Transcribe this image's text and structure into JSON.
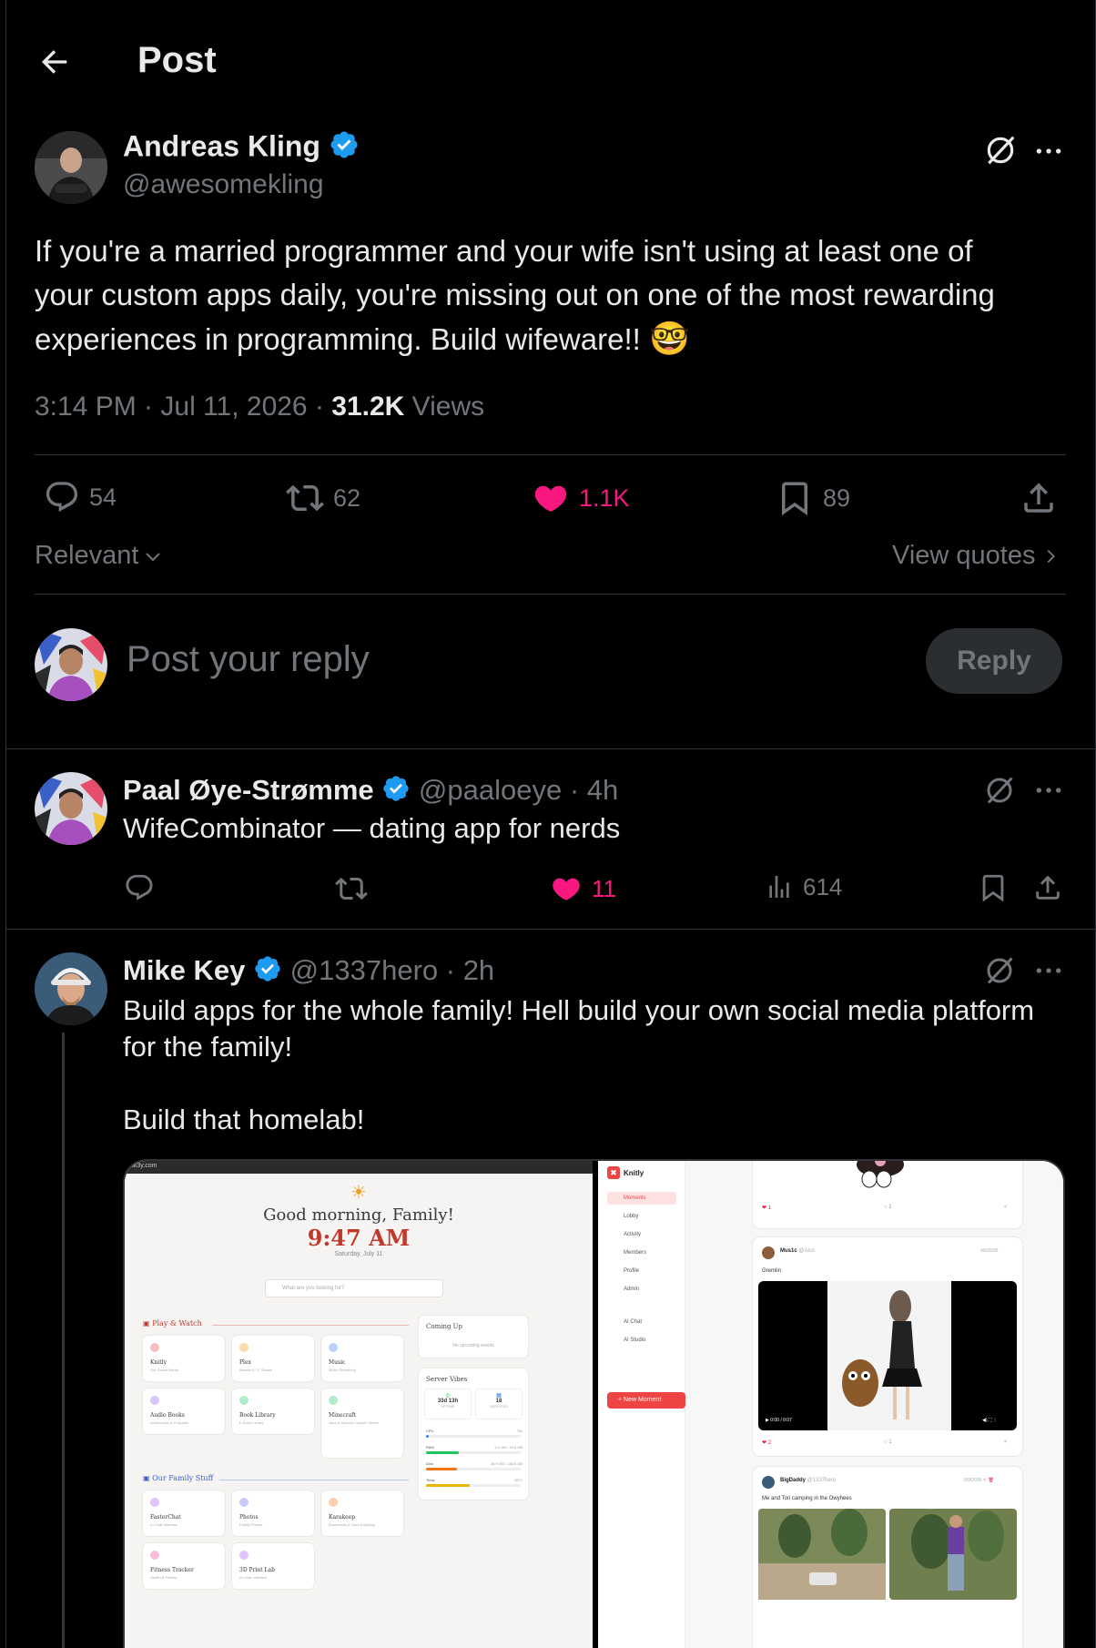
{
  "header": {
    "title": "Post"
  },
  "main_post": {
    "author_name": "Andreas Kling",
    "handle": "@awesomekling",
    "text_line1": "If you're a married programmer and your wife isn't using at least one of",
    "text_line2": "your custom apps daily, you're missing out on one of the most rewarding",
    "text_line3": "experiences in programming. Build wifeware!!",
    "emoji": "🤓",
    "time": "3:14 PM · Jul 11, 2026 · ",
    "views_count": "31.2K",
    "views_label": " Views",
    "replies": "54",
    "reposts": "62",
    "likes": "1.1K",
    "bookmarks": "89"
  },
  "sort": {
    "label": "Relevant",
    "view_quotes": "View quotes"
  },
  "composer": {
    "placeholder": "Post your reply",
    "button": "Reply"
  },
  "reply1": {
    "author_name": "Paal Øye-Strømme",
    "handle": "@paaloeye",
    "age": " · 4h",
    "text": "WifeCombinator — dating app for nerds",
    "likes": "11",
    "views": "614"
  },
  "reply2": {
    "author_name": "Mike Key",
    "handle": "@1337hero",
    "age": " · 2h",
    "text_line1": "Build apps for the whole family! Hell build your own social media platform",
    "text_line2": "for the family!",
    "text_line3": "Build that homelab!"
  },
  "screenshot_left": {
    "url": "nk3y.com",
    "greeting": "Good morning, Family!",
    "clock": "9:47 AM",
    "date": "Saturday, July 11",
    "search_placeholder": "What are you looking for?",
    "section1": "Play & Watch",
    "section2": "Our Family Stuff",
    "tiles": [
      {
        "name": "Knitly",
        "sub": "Our Social Media"
      },
      {
        "name": "Plex",
        "sub": "Movies & TV Shows"
      },
      {
        "name": "Music",
        "sub": "Music Streaming"
      },
      {
        "name": "Audio Books",
        "sub": "Audiobooks & Podcasts"
      },
      {
        "name": "Book Library",
        "sub": "E-Book Library"
      },
      {
        "name": "Minecraft",
        "sub": "Java & Bedrock Geyser Server"
      },
      {
        "name": "FasterChat",
        "sub": "AI Chat Interface"
      },
      {
        "name": "Photos",
        "sub": "Family Photos"
      },
      {
        "name": "Karakeep",
        "sub": "Bookmarks & Save Anything"
      },
      {
        "name": "Fitness Tracker",
        "sub": "Health & Fitness"
      },
      {
        "name": "3D Print Lab",
        "sub": "AI Chat Interface"
      }
    ],
    "coming_up": "Coming Up",
    "no_events": "No upcoming events",
    "server_vibes": "Server Vibes",
    "uptime_val": "33d 13h",
    "uptime_lbl": "UPTIME",
    "services_val": "18",
    "services_lbl": "SERVICES",
    "meters": [
      {
        "label": "CPU",
        "value": "3%",
        "pct": 0.03,
        "color": "#3b82f6"
      },
      {
        "label": "RAM",
        "value": "5.4 GB / 15.5 GB",
        "pct": 0.35,
        "color": "#22c55e"
      },
      {
        "label": "Disk",
        "value": "48.9 GB / 146.6 GB",
        "pct": 0.33,
        "color": "#f97316"
      },
      {
        "label": "Temp",
        "value": "46°C",
        "pct": 0.46,
        "color": "#eab308"
      }
    ]
  },
  "screenshot_right": {
    "app_name": "Knitly",
    "nav": [
      "Moments",
      "Lobby",
      "Activity",
      "Members",
      "Profile",
      "Admin",
      "AI Chat",
      "AI Studio"
    ],
    "new_moment": "+ New Moment",
    "post1_author": "Mus1c",
    "post1_handle": "@Also",
    "post1_date": "4/9/2026",
    "post1_caption": "Gremlin",
    "video_time": "0:00 / 0:07",
    "post1_likes": "2",
    "post1_comments": "1",
    "top_likes": "1",
    "top_comments": "1",
    "post2_author": "BigDaddy",
    "post2_handle": "@1337hero",
    "post2_date": "5/9/2026",
    "post2_caption": "Me and Tori camping in the Owyhees"
  },
  "colors": {
    "accent_blue": "#1d9bf0",
    "like_pink": "#f91880",
    "muted": "#71767b",
    "border": "#2f3336"
  }
}
